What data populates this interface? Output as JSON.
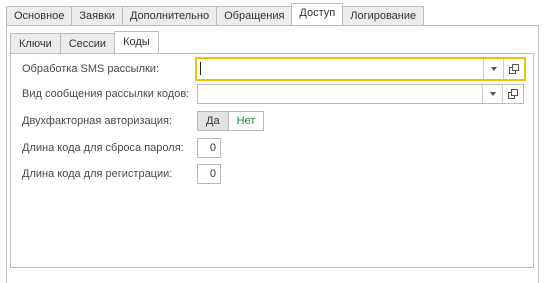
{
  "outer_tabs": [
    "Основное",
    "Заявки",
    "Дополнительно",
    "Обращения",
    "Доступ",
    "Логирование"
  ],
  "outer_active": "Доступ",
  "inner_tabs": [
    "Ключи",
    "Сессии",
    "Коды"
  ],
  "inner_active": "Коды",
  "form": {
    "sms_label": "Обработка SMS рассылки:",
    "sms_value": "",
    "msgtype_label": "Вид сообщения рассылки кодов:",
    "msgtype_value": "",
    "twofactor_label": "Двухфакторная авторизация:",
    "twofactor_yes": "Да",
    "twofactor_no": "Нет",
    "reset_len_label": "Длина кода для сброса пароля:",
    "reset_len_value": "0",
    "reg_len_label": "Длина кода для регистрации:",
    "reg_len_value": "0"
  },
  "icons": {
    "dropdown": "chevron-down-icon",
    "open": "open-form-icon"
  },
  "colors": {
    "focus_border": "#f2c300",
    "no_button_text": "#1f8a3c"
  }
}
